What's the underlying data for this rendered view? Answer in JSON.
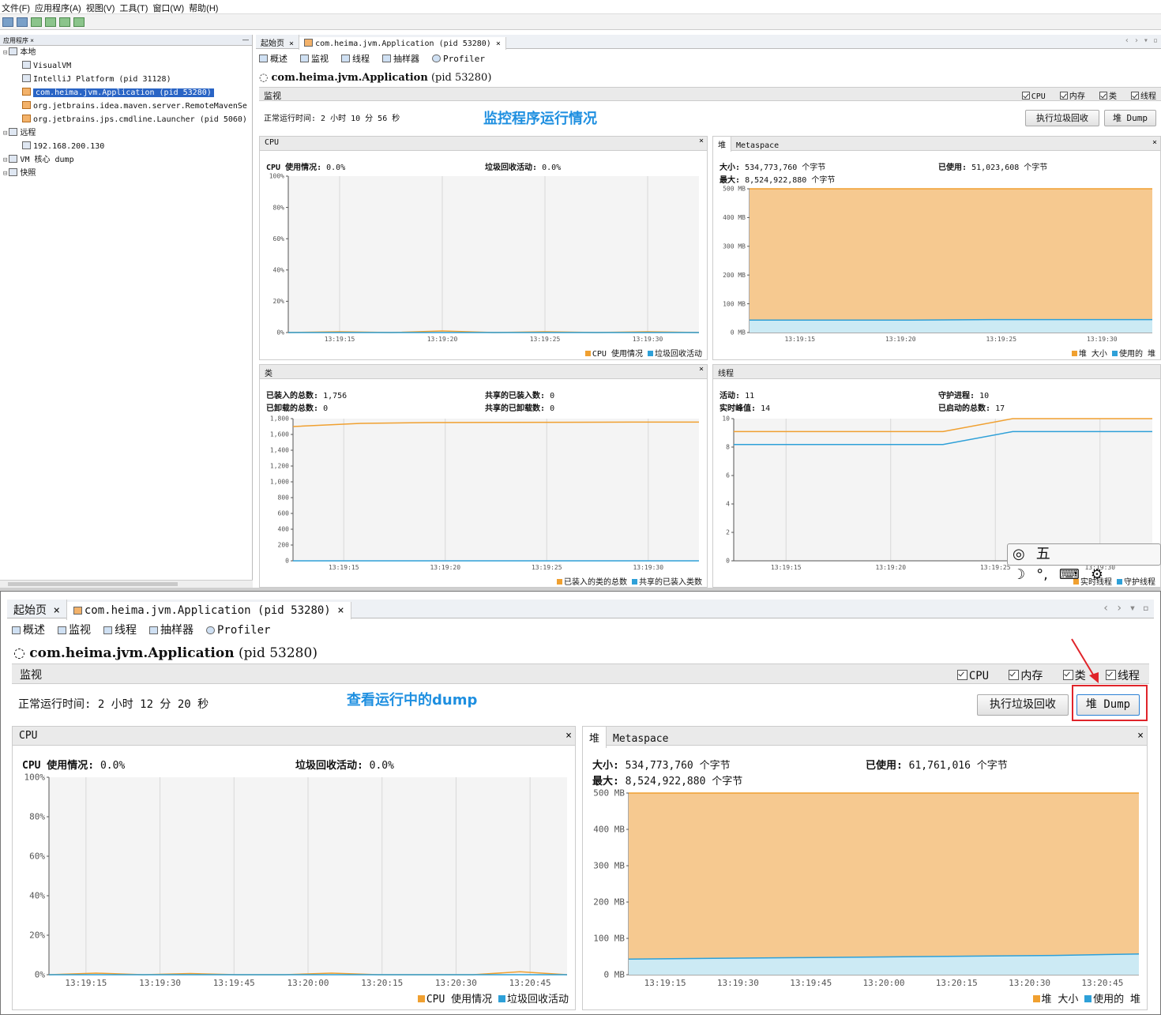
{
  "menu": [
    "文件(F)",
    "应用程序(A)",
    "视图(V)",
    "工具(T)",
    "窗口(W)",
    "帮助(H)"
  ],
  "sidebar": {
    "tab": "应用程序",
    "tab_close": "×",
    "collapse": "—",
    "items": [
      {
        "label": "本地",
        "level": 0,
        "icon": "computer-icon"
      },
      {
        "label": "VisualVM",
        "level": 1,
        "icon": "visualvm-icon"
      },
      {
        "label": "IntelliJ Platform (pid 31128)",
        "level": 1,
        "icon": "intellij-icon"
      },
      {
        "label": "com.heima.jvm.Application (pid 53280)",
        "level": 1,
        "icon": "java-icon",
        "selected": true
      },
      {
        "label": "org.jetbrains.idea.maven.server.RemoteMavenSe",
        "level": 1,
        "icon": "java-icon"
      },
      {
        "label": "org.jetbrains.jps.cmdline.Launcher (pid 5060)",
        "level": 1,
        "icon": "java-icon"
      },
      {
        "label": "远程",
        "level": 0,
        "icon": "remote-icon"
      },
      {
        "label": "192.168.200.130",
        "level": 1,
        "icon": "host-icon"
      },
      {
        "label": "VM 核心 dump",
        "level": 0,
        "icon": "core-dump-icon"
      },
      {
        "label": "快照",
        "level": 0,
        "icon": "snapshot-icon"
      }
    ]
  },
  "tabs": {
    "start": "起始页",
    "app": "com.heima.jvm.Application (pid 53280)",
    "close": "×"
  },
  "subtabs": {
    "overview": "概述",
    "monitor": "监视",
    "threads": "线程",
    "sampler": "抽样器",
    "profiler": "Profiler"
  },
  "app_title": {
    "name": "com.heima.jvm.Application",
    "pid": "(pid 53280)"
  },
  "monitor_label": "监视",
  "checkboxes": {
    "cpu": "CPU",
    "memory": "内存",
    "classes": "类",
    "threads": "线程"
  },
  "buttons": {
    "gc": "执行垃圾回收",
    "heap_dump": "堆 Dump"
  },
  "top": {
    "uptime": "正常运行时间: 2 小时 10 分 56 秒",
    "annotation": "监控程序运行情况",
    "cpu": {
      "title": "CPU",
      "usage_label": "CPU 使用情况:",
      "usage": "0.0%",
      "gc_label": "垃圾回收活动:",
      "gc": "0.0%",
      "legend1": "CPU 使用情况",
      "legend2": "垃圾回收活动"
    },
    "heap": {
      "tab1": "堆",
      "tab2": "Metaspace",
      "size_label": "大小:",
      "size": "534,773,760 个字节",
      "max_label": "最大:",
      "max": "8,524,922,880 个字节",
      "used_label": "已使用:",
      "used": "51,023,608 个字节",
      "legend1": "堆 大小",
      "legend2": "使用的 堆"
    },
    "classes": {
      "title": "类",
      "loaded_label": "已装入的总数:",
      "loaded": "1,756",
      "unloaded_label": "已卸载的总数:",
      "unloaded": "0",
      "shared_loaded_label": "共享的已装入数:",
      "shared_loaded": "0",
      "shared_unloaded_label": "共享的已卸载数:",
      "shared_unloaded": "0",
      "legend1": "已装入的类的总数",
      "legend2": "共享的已装入类数"
    },
    "threads": {
      "title": "线程",
      "live_label": "活动:",
      "live": "11",
      "peak_label": "实时峰值:",
      "peak": "14",
      "daemon_label": "守护进程:",
      "daemon": "10",
      "started_label": "已启动的总数:",
      "started": "17",
      "legend1": "实时线程",
      "legend2": "守护线程"
    }
  },
  "bottom": {
    "uptime": "正常运行时间: 2 小时 12 分 20 秒",
    "annotation": "查看运行中的dump",
    "cpu": {
      "title": "CPU",
      "usage_label": "CPU 使用情况:",
      "usage": "0.0%",
      "gc_label": "垃圾回收活动:",
      "gc": "0.0%",
      "legend1": "CPU 使用情况",
      "legend2": "垃圾回收活动"
    },
    "heap": {
      "tab1": "堆",
      "tab2": "Metaspace",
      "size_label": "大小:",
      "size": "534,773,760 个字节",
      "max_label": "最大:",
      "max": "8,524,922,880 个字节",
      "used_label": "已使用:",
      "used": "61,761,016 个字节",
      "legend1": "堆 大小",
      "legend2": "使用的 堆"
    }
  },
  "ime": [
    "五",
    "☽",
    "°,",
    "⌨",
    "⚙"
  ],
  "colors": {
    "orange": "#f0a030",
    "blue": "#2ea0d8",
    "heap_fill": "#f6c990",
    "used_fill": "#c9ecfa",
    "selection": "#2964c5",
    "annotation": "#1e8fe0",
    "highlight": "#e0242a"
  },
  "chart_data": [
    {
      "id": "top-cpu",
      "type": "area",
      "x": [
        "13:19:15",
        "13:19:20",
        "13:19:25",
        "13:19:30"
      ],
      "yticks": [
        "100%",
        "80%",
        "60%",
        "40%",
        "20%",
        "0%"
      ],
      "ylim": [
        0,
        100
      ],
      "series": [
        {
          "name": "CPU 使用情况",
          "values": [
            0,
            0.5,
            0,
            1,
            0,
            0.5,
            0,
            0.5,
            0
          ]
        },
        {
          "name": "垃圾回收活动",
          "values": [
            0,
            0,
            0,
            0,
            0,
            0,
            0,
            0,
            0
          ]
        }
      ]
    },
    {
      "id": "top-heap",
      "type": "area",
      "x": [
        "13:19:15",
        "13:19:20",
        "13:19:25",
        "13:19:30"
      ],
      "yticks": [
        "500 MB",
        "400 MB",
        "300 MB",
        "200 MB",
        "100 MB",
        "0 MB"
      ],
      "ylim": [
        0,
        510
      ],
      "series": [
        {
          "name": "堆 大小",
          "values": [
            510,
            510,
            510,
            510,
            510,
            510
          ]
        },
        {
          "name": "使用的 堆",
          "values": [
            44,
            44,
            44,
            46,
            46,
            46
          ]
        }
      ]
    },
    {
      "id": "top-classes",
      "type": "line",
      "x": [
        "13:19:15",
        "13:19:20",
        "13:19:25",
        "13:19:30"
      ],
      "yticks": [
        "1,800",
        "1,600",
        "1,400",
        "1,200",
        "1,000",
        "800",
        "600",
        "400",
        "200",
        "0"
      ],
      "ylim": [
        0,
        1800
      ],
      "series": [
        {
          "name": "已装入的类的总数",
          "values": [
            1700,
            1740,
            1750,
            1752,
            1754,
            1756,
            1756
          ]
        },
        {
          "name": "共享的已装入类数",
          "values": [
            0,
            0,
            0,
            0,
            0,
            0,
            0
          ]
        }
      ]
    },
    {
      "id": "top-threads",
      "type": "line",
      "x": [
        "13:19:15",
        "13:19:20",
        "13:19:25",
        "13:19:30"
      ],
      "yticks": [
        "10",
        "8",
        "6",
        "4",
        "2",
        "0"
      ],
      "ylim": [
        0,
        11
      ],
      "series": [
        {
          "name": "实时线程",
          "values": [
            10,
            10,
            10,
            10,
            11,
            11,
            11
          ]
        },
        {
          "name": "守护线程",
          "values": [
            9,
            9,
            9,
            9,
            10,
            10,
            10
          ]
        }
      ]
    },
    {
      "id": "bottom-cpu",
      "type": "area",
      "x": [
        "13:19:15",
        "13:19:30",
        "13:19:45",
        "13:20:00",
        "13:20:15",
        "13:20:30",
        "13:20:45"
      ],
      "yticks": [
        "100%",
        "80%",
        "60%",
        "40%",
        "20%",
        "0%"
      ],
      "ylim": [
        0,
        100
      ],
      "series": [
        {
          "name": "CPU 使用情况",
          "values": [
            0,
            0.8,
            0,
            0.6,
            0,
            0,
            0.8,
            0,
            0,
            0,
            1.5,
            0
          ]
        },
        {
          "name": "垃圾回收活动",
          "values": [
            0,
            0,
            0,
            0,
            0,
            0,
            0,
            0,
            0,
            0,
            0,
            0
          ]
        }
      ]
    },
    {
      "id": "bottom-heap",
      "type": "area",
      "x": [
        "13:19:15",
        "13:19:30",
        "13:19:45",
        "13:20:00",
        "13:20:15",
        "13:20:30",
        "13:20:45"
      ],
      "yticks": [
        "500 MB",
        "400 MB",
        "300 MB",
        "200 MB",
        "100 MB",
        "0 MB"
      ],
      "ylim": [
        0,
        510
      ],
      "series": [
        {
          "name": "堆 大小",
          "values": [
            510,
            510,
            510,
            510,
            510,
            510,
            510
          ]
        },
        {
          "name": "使用的 堆",
          "values": [
            44,
            46,
            48,
            50,
            52,
            54,
            58
          ]
        }
      ]
    }
  ]
}
